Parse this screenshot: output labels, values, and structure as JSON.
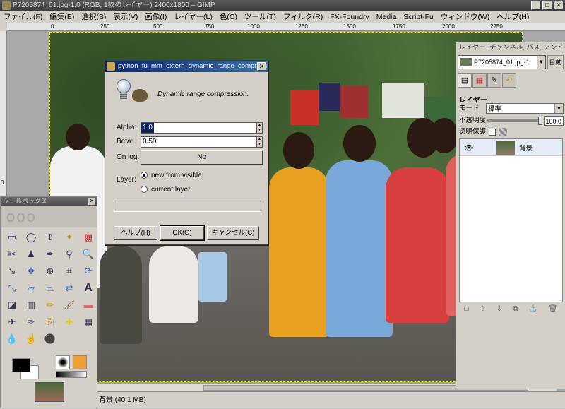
{
  "window": {
    "title": "P7205874_01.jpg-1.0 (RGB, 1枚のレイヤー) 2400x1800 – GIMP",
    "controls": [
      "_",
      "□",
      "✕"
    ]
  },
  "menu": [
    "ファイル(F)",
    "編集(E)",
    "選択(S)",
    "表示(V)",
    "画像(I)",
    "レイヤー(L)",
    "色(C)",
    "ツール(T)",
    "フィルタ(R)",
    "FX-Foundry",
    "Media",
    "Script-Fu",
    "ウィンドウ(W)",
    "ヘルプ(H)"
  ],
  "ruler": [
    "0",
    "250",
    "500",
    "750",
    "1000",
    "1250",
    "1500",
    "1750",
    "2000",
    "2250"
  ],
  "ruler_left": "0",
  "dialog": {
    "title": "python_fu_mm_extern_dynamic_range_compressi...",
    "close": "✕",
    "description": "Dynamic range compression.",
    "alpha_label": "Alpha:",
    "alpha_value": "1.0",
    "beta_label": "Beta:",
    "beta_value": "0.50",
    "onlog_label": "On log:",
    "onlog_value": "No",
    "layer_label": "Layer:",
    "radio1": "new from visible",
    "radio2": "current layer",
    "help_btn": "ヘルプ(H)",
    "ok_btn": "OK(O)",
    "cancel_btn": "キャンセル(C)"
  },
  "toolbox": {
    "title": "ツールボックス",
    "close": "✕",
    "logo": "ooo"
  },
  "dock": {
    "title": "レイヤー, チャンネル, パス, アンドゥ",
    "image_select": "P7205874_01.jpg-1",
    "auto": "自動",
    "section": "レイヤー",
    "mode_label": "モード",
    "mode_value": "標準",
    "opacity_label": "不透明度:",
    "opacity_value": "100.0",
    "lock_label": "透明保護",
    "layer_name": "背景",
    "bottom_icons": [
      "□",
      "⇧",
      "⇩",
      "⧉",
      "⚓",
      "🗑"
    ]
  },
  "status": "背景 (40.1 MB)",
  "colors": {
    "dialog_title_start": "#0a246a",
    "dialog_title_end": "#3a6ea5",
    "panel": "#d4d0c8"
  }
}
